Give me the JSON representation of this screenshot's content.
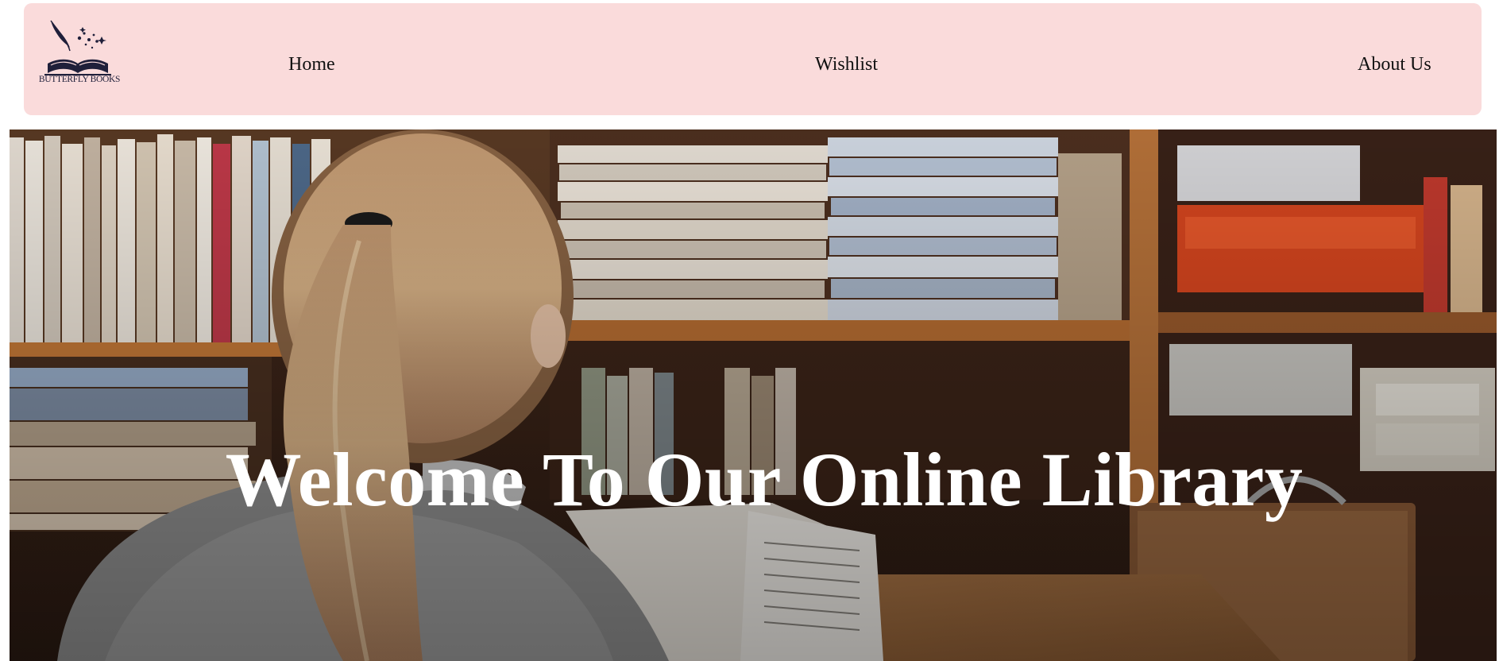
{
  "brand": {
    "logo_text": "BUTTERFLY BOOKS",
    "logo_color": "#1f1f3a"
  },
  "nav": {
    "background": "#fadbdb",
    "items": [
      {
        "label": "Home"
      },
      {
        "label": "Wishlist"
      },
      {
        "label": "About Us"
      }
    ]
  },
  "hero": {
    "title": "Welcome To Our Online Library",
    "image": "woman-reading-in-library-photo"
  }
}
